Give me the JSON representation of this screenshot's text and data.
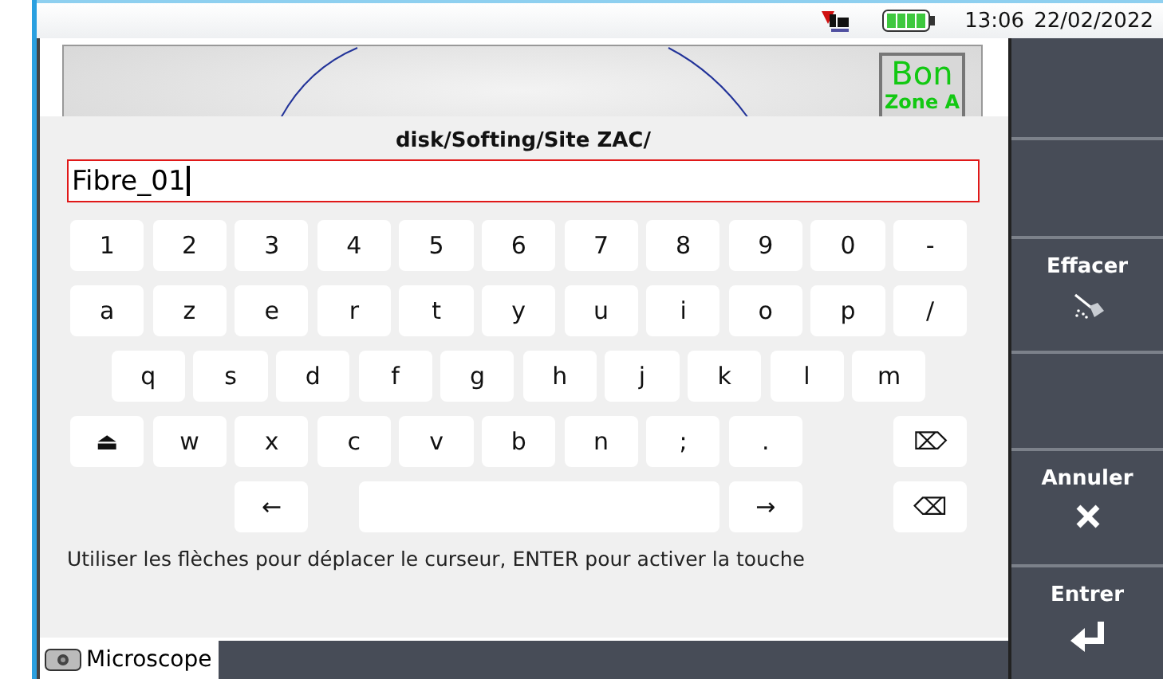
{
  "status_bar": {
    "time": "13:06",
    "date": "22/02/2022"
  },
  "scope_view": {
    "verdict": "Bon",
    "zone": "Zone A"
  },
  "dialog": {
    "path": "disk/Softing/Site ZAC/",
    "value": "Fibre_01",
    "rows": [
      [
        {
          "kind": "char",
          "label": "1"
        },
        {
          "kind": "char",
          "label": "2"
        },
        {
          "kind": "char",
          "label": "3"
        },
        {
          "kind": "char",
          "label": "4"
        },
        {
          "kind": "char",
          "label": "5"
        },
        {
          "kind": "char",
          "label": "6"
        },
        {
          "kind": "char",
          "label": "7"
        },
        {
          "kind": "char",
          "label": "8"
        },
        {
          "kind": "char",
          "label": "9"
        },
        {
          "kind": "char",
          "label": "0"
        },
        {
          "kind": "char",
          "label": "-"
        }
      ],
      [
        {
          "kind": "char",
          "label": "a"
        },
        {
          "kind": "char",
          "label": "z"
        },
        {
          "kind": "char",
          "label": "e"
        },
        {
          "kind": "char",
          "label": "r"
        },
        {
          "kind": "char",
          "label": "t"
        },
        {
          "kind": "char",
          "label": "y"
        },
        {
          "kind": "char",
          "label": "u"
        },
        {
          "kind": "char",
          "label": "i"
        },
        {
          "kind": "char",
          "label": "o"
        },
        {
          "kind": "char",
          "label": "p"
        },
        {
          "kind": "char",
          "label": "/"
        }
      ],
      [
        {
          "kind": "offset"
        },
        {
          "kind": "char",
          "label": "q"
        },
        {
          "kind": "char",
          "label": "s"
        },
        {
          "kind": "char",
          "label": "d"
        },
        {
          "kind": "char",
          "label": "f"
        },
        {
          "kind": "char",
          "label": "g"
        },
        {
          "kind": "char",
          "label": "h"
        },
        {
          "kind": "char",
          "label": "j"
        },
        {
          "kind": "char",
          "label": "k"
        },
        {
          "kind": "char",
          "label": "l"
        },
        {
          "kind": "char",
          "label": "m"
        }
      ],
      [
        {
          "kind": "char",
          "label": "⏏"
        },
        {
          "kind": "char",
          "label": "w"
        },
        {
          "kind": "char",
          "label": "x"
        },
        {
          "kind": "char",
          "label": "c"
        },
        {
          "kind": "char",
          "label": "v"
        },
        {
          "kind": "char",
          "label": "b"
        },
        {
          "kind": "char",
          "label": "n"
        },
        {
          "kind": "char",
          "label": ";"
        },
        {
          "kind": "char",
          "label": "."
        },
        {
          "kind": "gap"
        },
        {
          "kind": "char",
          "label": "⌦"
        }
      ],
      [
        {
          "kind": "gap"
        },
        {
          "kind": "gap"
        },
        {
          "kind": "char",
          "label": "←"
        },
        {
          "kind": "space"
        },
        {
          "kind": "gap"
        },
        {
          "kind": "gap"
        },
        {
          "kind": "gap"
        },
        {
          "kind": "gap"
        },
        {
          "kind": "char",
          "label": "→"
        },
        {
          "kind": "gap"
        },
        {
          "kind": "char",
          "label": "⌫"
        }
      ]
    ],
    "hint": "Utiliser les flèches pour déplacer le curseur, ENTER pour activer la touche"
  },
  "side_panel": [
    {
      "kind": "empty"
    },
    {
      "kind": "empty"
    },
    {
      "kind": "broom",
      "label": "Effacer"
    },
    {
      "kind": "empty"
    },
    {
      "kind": "close",
      "label": "Annuler"
    },
    {
      "kind": "enter",
      "label": "Entrer"
    }
  ],
  "bottom_bar": {
    "tab": "Microscope"
  }
}
